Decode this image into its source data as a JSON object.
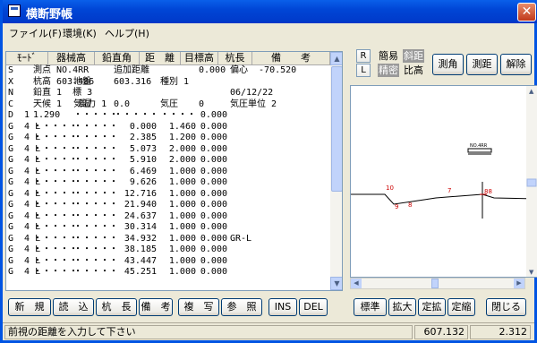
{
  "window": {
    "title": "横断野帳",
    "close": "✕"
  },
  "menu": [
    "ファイル(F)",
    "環境(K)",
    "ヘルプ(H)"
  ],
  "table": {
    "headers": [
      "ﾓｰﾄﾞ",
      "器械高",
      "鉛直角",
      "距　離",
      "目標高",
      "杭長",
      "備　　考"
    ],
    "rows": [
      [
        "S",
        "測点 NO.4RR",
        "",
        "追加距離",
        "",
        "0.000",
        "偏心  -70.520"
      ],
      [
        "X",
        "杭高 603.486",
        "地盤",
        "603.316",
        "種別 1",
        "",
        ""
      ],
      [
        "N",
        "鉛直 1  標 3",
        "",
        "",
        "",
        "",
        "06/12/22"
      ],
      [
        "C",
        "天候 1   風力 1",
        "気温",
        "0.0",
        "気圧",
        "0",
        "気圧単位 2"
      ],
      [
        "D  1",
        "1.290",
        "・・・・・",
        "・・・・・",
        "・・・・",
        "0.000",
        ""
      ],
      [
        "G  4 L",
        "・・・・・",
        "・・・・・",
        "0.000",
        "1.460",
        "0.000",
        ""
      ],
      [
        "G  4 L",
        "・・・・・",
        "・・・・・",
        "2.385",
        "1.200",
        "0.000",
        ""
      ],
      [
        "G  4 L",
        "・・・・・",
        "・・・・・",
        "5.073",
        "2.000",
        "0.000",
        ""
      ],
      [
        "G  4 L",
        "・・・・・",
        "・・・・・",
        "5.910",
        "2.000",
        "0.000",
        ""
      ],
      [
        "G  4 L",
        "・・・・・",
        "・・・・・",
        "6.469",
        "1.000",
        "0.000",
        ""
      ],
      [
        "G  4 L",
        "・・・・・",
        "・・・・・",
        "9.626",
        "1.000",
        "0.000",
        ""
      ],
      [
        "G  4 L",
        "・・・・・",
        "・・・・・",
        "12.716",
        "1.000",
        "0.000",
        ""
      ],
      [
        "G  4 L",
        "・・・・・",
        "・・・・・",
        "21.940",
        "1.000",
        "0.000",
        ""
      ],
      [
        "G  4 L",
        "・・・・・",
        "・・・・・",
        "24.637",
        "1.000",
        "0.000",
        ""
      ],
      [
        "G  4 L",
        "・・・・・",
        "・・・・・",
        "30.314",
        "1.000",
        "0.000",
        ""
      ],
      [
        "G  4 L",
        "・・・・・",
        "・・・・・",
        "34.932",
        "1.000",
        "0.000",
        "GR-L"
      ],
      [
        "G  4 L",
        "・・・・・",
        "・・・・・",
        "38.185",
        "1.000",
        "0.000",
        ""
      ],
      [
        "G  4 L",
        "・・・・・",
        "・・・・・",
        "43.447",
        "1.000",
        "0.000",
        ""
      ],
      [
        "G  4 L",
        "・・・・・",
        "・・・・・",
        "45.251",
        "1.000",
        "0.000",
        ""
      ]
    ]
  },
  "right_top": {
    "R": "R",
    "L": "L",
    "kanni": "簡易",
    "seimitsu": "精密",
    "shakyori": "斜距",
    "hiko": "比高",
    "sokkaku": "測角",
    "sokkyo": "測距",
    "kaijo": "解除"
  },
  "plot": {
    "labels": [
      "10",
      "9",
      "8",
      "7",
      "88"
    ],
    "marker_label": "NO.4RR"
  },
  "buttons_left": [
    "新　規",
    "読　込",
    "杭　長",
    "備　考",
    "複　写",
    "参　照",
    "INS",
    "DEL"
  ],
  "buttons_right": [
    "標準",
    "拡大",
    "定拡",
    "定縮",
    "閉じる"
  ],
  "status": {
    "message": "前視の距離を入力して下さい",
    "value1": "607.132",
    "value2": "2.312"
  }
}
